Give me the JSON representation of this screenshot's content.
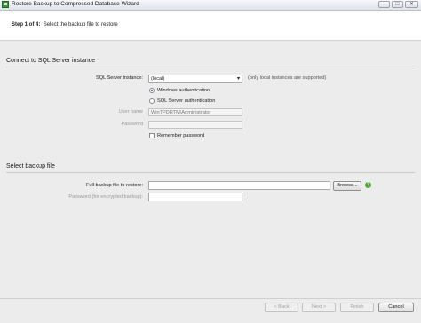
{
  "window": {
    "title": "Restore Backup to Compressed Database Wizard",
    "minimize_glyph": "–",
    "maximize_glyph": "□",
    "close_glyph": "✕"
  },
  "header": {
    "step_label": "Step 1 of 4:",
    "step_text": "Select the backup file to restore"
  },
  "connect": {
    "heading": "Connect to SQL Server instance",
    "instance_label": "SQL Server instance:",
    "instance_value": "(local)",
    "instance_note": "(only local instances are supported)",
    "windows_auth_label": "Windows authentication",
    "sql_auth_label": "SQL Server authentication",
    "username_label": "User name",
    "username_value": "WinTPDRTM\\Administrator",
    "password_label": "Password",
    "password_value": "",
    "remember_label": "Remember password"
  },
  "backup": {
    "heading": "Select backup file",
    "file_label": "Full backup file to restore:",
    "file_value": "",
    "browse_label": "Browse...",
    "enc_password_label": "Password (for encrypted backup):",
    "enc_password_value": ""
  },
  "footer": {
    "back_label": "< Back",
    "next_label": "Next >",
    "finish_label": "Finish",
    "cancel_label": "Cancel"
  },
  "state": {
    "auth_mode": "windows",
    "remember_password": false
  },
  "colors": {
    "help_icon": "#4caf2e",
    "app_icon": "#3a9a3a",
    "panel_bg": "#ececec"
  }
}
